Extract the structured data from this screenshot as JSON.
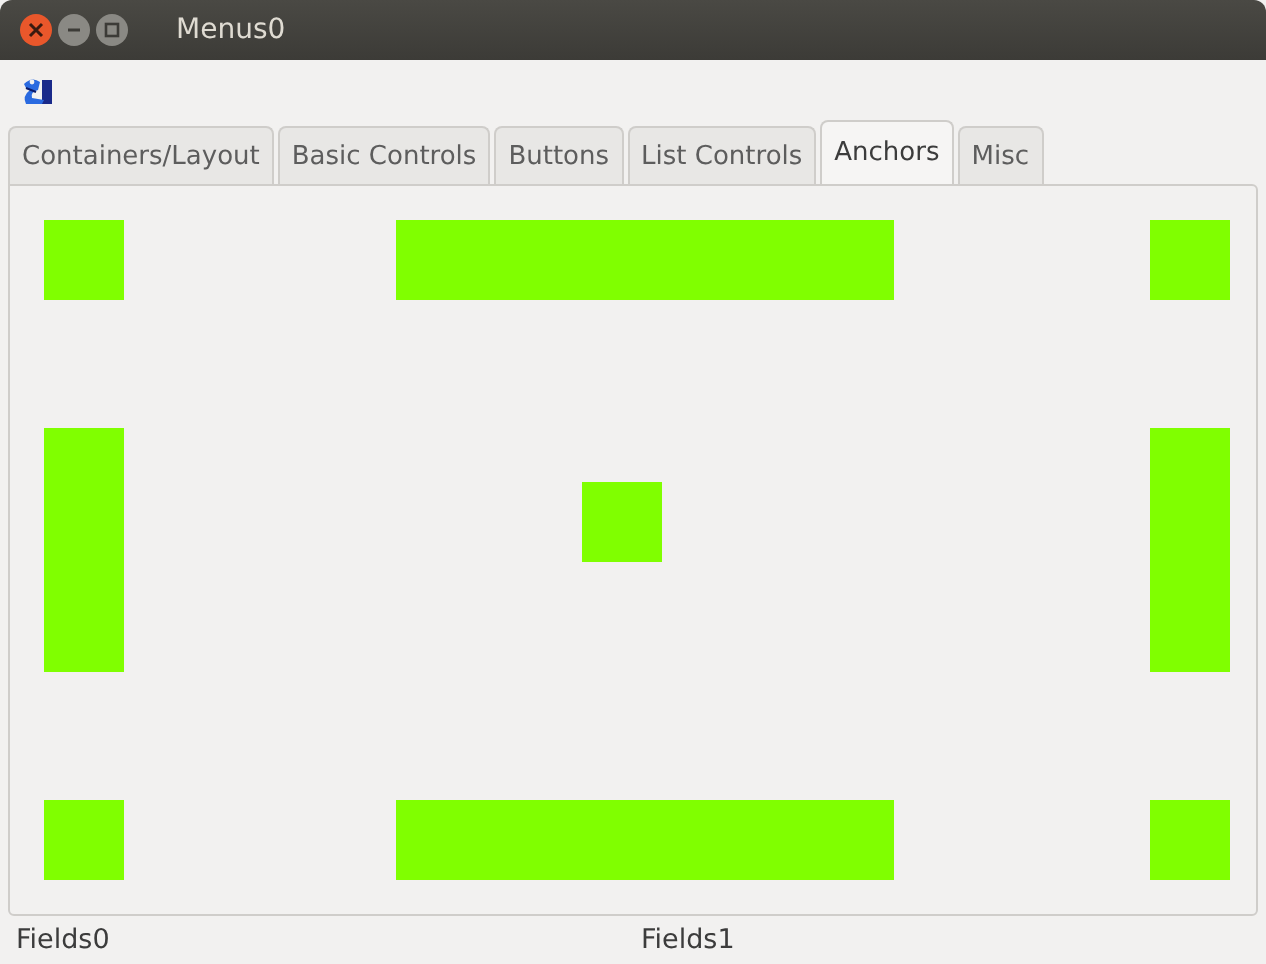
{
  "window": {
    "title": "Menus0"
  },
  "tabs": [
    {
      "label": "Containers/Layout",
      "selected": false
    },
    {
      "label": "Basic Controls",
      "selected": false
    },
    {
      "label": "Buttons",
      "selected": false
    },
    {
      "label": "List Controls",
      "selected": false
    },
    {
      "label": "Anchors",
      "selected": true
    },
    {
      "label": "Misc",
      "selected": false
    }
  ],
  "status_bar": [
    "Fields0",
    "Fields1"
  ]
}
